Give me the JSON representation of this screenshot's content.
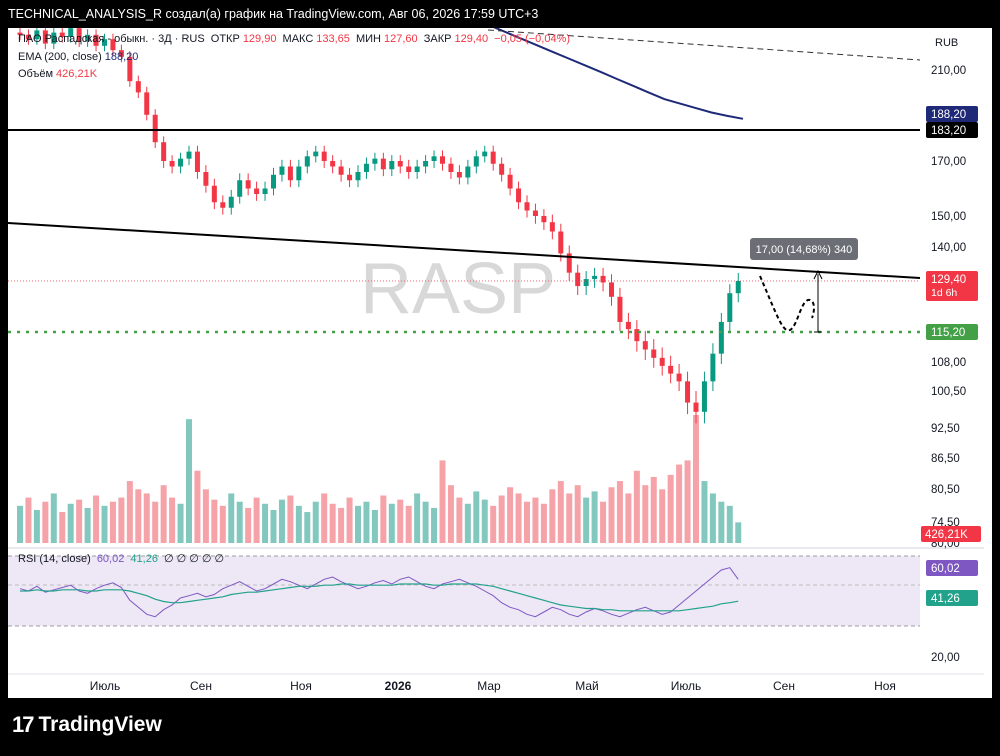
{
  "header": {
    "caption": "TECHNICAL_ANALYSIS_R создал(а) график на TradingView.com, Авг 06, 2026 17:59 UTC+3"
  },
  "legend": {
    "symbol": "ПАО Распадская - обыкн. · 3Д · RUS",
    "o_label": "ОТКР",
    "o_value": "129,90",
    "h_label": "МАКС",
    "h_value": "133,65",
    "l_label": "МИН",
    "l_value": "127,60",
    "c_label": "ЗАКР",
    "c_value": "129,40",
    "change": "−0,05 (−0,04%)",
    "ema_label": "EMA (200, close)",
    "ema_value": "188,20",
    "vol_label": "Объём",
    "vol_value": "426,21K",
    "rsi_label": "RSI (14, close)",
    "rsi_value": "60,02",
    "rsi_ma_value": "41,26",
    "rsi_na": "∅ ∅ ∅ ∅ ∅"
  },
  "watermark": "RASP",
  "branding": {
    "name": "TradingView",
    "mark": "17"
  },
  "colors": {
    "up": "#089981",
    "down": "#f23645",
    "vol_up": "#83c8bf",
    "vol_down": "#f5a3a9",
    "ema": "#1e2a78",
    "rsi": "#7e57c2",
    "rsi_ma": "#22a28a",
    "support": "#43a047",
    "price_label": "#f23645",
    "ema_label": "#1e2a78"
  },
  "chart_data": {
    "type": "candlestick",
    "currency": "RUB",
    "x_ticks": [
      "Июль",
      "Сен",
      "Ноя",
      "2026",
      "Мар",
      "Май",
      "Июль",
      "Сен",
      "Ноя"
    ],
    "y_ticks": [
      "210,00",
      "170,00",
      "150,00",
      "140,00",
      "108,00",
      "100,50",
      "92,50",
      "86,50",
      "80,50",
      "74,50"
    ],
    "rsi_ticks": [
      "80,00",
      "20,00"
    ],
    "price_labels": {
      "ema": "188,20",
      "resistance": "183,20",
      "last": "129,40",
      "countdown": "1d 6h",
      "support": "115,20",
      "volume": "426,21K",
      "rsi": "60,02",
      "rsi_ma": "41,26"
    },
    "horizontal_levels": {
      "resistance": 183.2,
      "support": 115.2
    },
    "measure_label": "17,00 (14,68%) 340",
    "closes": [
      226,
      224,
      228,
      222,
      227,
      225,
      229,
      223,
      226,
      221,
      224,
      219,
      216,
      205,
      200,
      190,
      178,
      170,
      168,
      171,
      174,
      166,
      161,
      155,
      153,
      157,
      163,
      160,
      158,
      160,
      165,
      168,
      163,
      168,
      172,
      174,
      170,
      168,
      165,
      163,
      166,
      169,
      171,
      167,
      170,
      168,
      166,
      168,
      170,
      172,
      169,
      166,
      164,
      168,
      172,
      174,
      169,
      165,
      160,
      155,
      152,
      150,
      148,
      145,
      138,
      132,
      128,
      130,
      131,
      129,
      125,
      118,
      116,
      113,
      111,
      109,
      107,
      105,
      103,
      98,
      96,
      103,
      110,
      118,
      126,
      129.4
    ],
    "volumes": [
      18,
      22,
      16,
      20,
      24,
      15,
      19,
      21,
      17,
      23,
      18,
      20,
      22,
      30,
      26,
      24,
      20,
      28,
      22,
      19,
      60,
      35,
      26,
      21,
      18,
      24,
      20,
      17,
      22,
      19,
      16,
      21,
      23,
      18,
      15,
      20,
      24,
      19,
      17,
      22,
      18,
      20,
      16,
      23,
      19,
      21,
      18,
      24,
      20,
      17,
      40,
      28,
      22,
      19,
      25,
      21,
      18,
      23,
      27,
      24,
      20,
      22,
      19,
      26,
      30,
      24,
      28,
      22,
      25,
      20,
      27,
      30,
      24,
      35,
      28,
      32,
      26,
      33,
      38,
      40,
      62,
      30,
      24,
      20,
      18,
      10
    ],
    "ema": [
      238,
      236,
      234,
      232,
      230,
      227,
      224,
      221,
      218,
      215,
      212,
      209,
      206,
      203,
      200,
      197,
      195,
      193,
      191,
      189.5,
      188.2
    ],
    "rsi": [
      52,
      50,
      54,
      49,
      51,
      53,
      55,
      50,
      48,
      52,
      55,
      57,
      53,
      42,
      36,
      30,
      28,
      34,
      38,
      44,
      46,
      48,
      45,
      47,
      52,
      55,
      58,
      54,
      50,
      52,
      56,
      60,
      58,
      55,
      52,
      56,
      60,
      62,
      58,
      55,
      52,
      54,
      57,
      59,
      56,
      60,
      62,
      58,
      54,
      52,
      56,
      58,
      60,
      57,
      54,
      50,
      46,
      40,
      36,
      34,
      30,
      28,
      32,
      36,
      34,
      30,
      28,
      32,
      35,
      33,
      30,
      28,
      31,
      34,
      36,
      33,
      30,
      32,
      38,
      44,
      50,
      56,
      62,
      68,
      70,
      60.02
    ],
    "rsi_ma": [
      50,
      50,
      51,
      50,
      50,
      51,
      51,
      51,
      50,
      50,
      51,
      51,
      51,
      50,
      48,
      46,
      43,
      41,
      40,
      40,
      41,
      42,
      43,
      44,
      45,
      47,
      48,
      49,
      49,
      50,
      51,
      52,
      53,
      54,
      54,
      54,
      55,
      55,
      56,
      56,
      55,
      55,
      55,
      55,
      55,
      56,
      56,
      56,
      56,
      55,
      55,
      56,
      56,
      56,
      56,
      55,
      54,
      52,
      50,
      48,
      46,
      44,
      42,
      40,
      38,
      37,
      36,
      35,
      35,
      34,
      34,
      33,
      33,
      33,
      33,
      33,
      33,
      33,
      33,
      34,
      35,
      36,
      37,
      39,
      40,
      41.26
    ]
  }
}
